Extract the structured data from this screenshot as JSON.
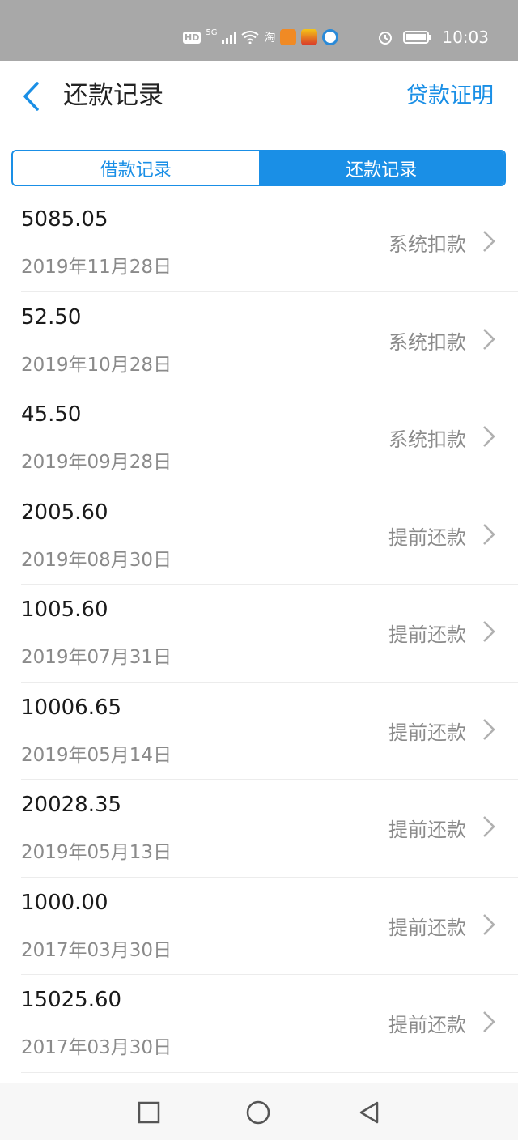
{
  "status_bar": {
    "hd": "HD",
    "network": "5G",
    "tao_icon": "淘",
    "time": "10:03",
    "icons": [
      "hd-icon",
      "signal-icon",
      "wifi-icon",
      "taobao-icon",
      "app-icon-orange",
      "app-icon-sogou",
      "app-icon-blue",
      "alarm-icon",
      "battery-icon"
    ]
  },
  "header": {
    "title": "还款记录",
    "right_link": "贷款证明"
  },
  "tabs": [
    {
      "label": "借款记录",
      "active": false
    },
    {
      "label": "还款记录",
      "active": true
    }
  ],
  "records": [
    {
      "amount": "5085.05",
      "date": "2019年11月28日",
      "type": "系统扣款"
    },
    {
      "amount": "52.50",
      "date": "2019年10月28日",
      "type": "系统扣款"
    },
    {
      "amount": "45.50",
      "date": "2019年09月28日",
      "type": "系统扣款"
    },
    {
      "amount": "2005.60",
      "date": "2019年08月30日",
      "type": "提前还款"
    },
    {
      "amount": "1005.60",
      "date": "2019年07月31日",
      "type": "提前还款"
    },
    {
      "amount": "10006.65",
      "date": "2019年05月14日",
      "type": "提前还款"
    },
    {
      "amount": "20028.35",
      "date": "2019年05月13日",
      "type": "提前还款"
    },
    {
      "amount": "1000.00",
      "date": "2017年03月30日",
      "type": "提前还款"
    },
    {
      "amount": "15025.60",
      "date": "2017年03月30日",
      "type": "提前还款"
    }
  ],
  "colors": {
    "accent": "#1a8fe6",
    "status_bar": "#a8a8a8",
    "text_primary": "#1a1a1a",
    "text_secondary": "#8a8a8a"
  },
  "nav_icons": [
    "square-icon",
    "circle-icon",
    "triangle-back-icon"
  ]
}
